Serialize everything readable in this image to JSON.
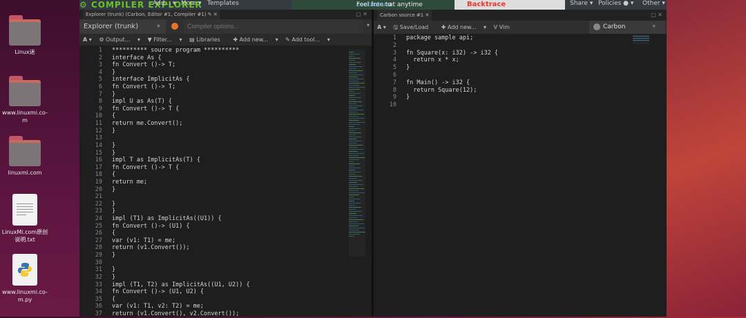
{
  "desktop": {
    "icons": [
      {
        "label": "Linux迷",
        "type": "folder"
      },
      {
        "label": "www.linuxmi.co-m",
        "type": "folder"
      },
      {
        "label": "linuxmi.com",
        "type": "folder"
      },
      {
        "label": "LinuxMi.com原创说明.txt",
        "type": "text-file"
      },
      {
        "label": "www.linuxmi.co-m.py",
        "type": "python-file"
      }
    ]
  },
  "nav": {
    "logo": "COMPILER EXPLORER",
    "add": "Add...",
    "more": "More",
    "templates": "Templates",
    "notice_prefix": "Feel free to ",
    "notice_link": "contact us",
    "notice_suffix": " at anytime",
    "sponsor": "Backtrace",
    "share": "Share",
    "policies": "Policies",
    "other": "Other"
  },
  "compiler_pane": {
    "tab": "Explorer (trunk) (Carbon, Editor #1, Compiler #1)",
    "compiler": "Explorer (trunk)",
    "options_placeholder": "Compiler options...",
    "toolbar": {
      "font": "A",
      "output": "Output...",
      "filter": "Filter...",
      "libraries": "Libraries",
      "add_new": "Add new...",
      "add_tool": "Add tool..."
    },
    "lines": [
      "********** source program **********",
      "interface As {",
      "fn Convert ()-> T;",
      "}",
      "interface ImplicitAs {",
      "fn Convert ()-> T;",
      "}",
      "impl U as As(T) {",
      "fn Convert ()-> T {",
      "{",
      "return me.Convert();",
      "}",
      "",
      "}",
      "}",
      "impl T as ImplicitAs(T) {",
      "fn Convert ()-> T {",
      "{",
      "return me;",
      "}",
      "",
      "}",
      "}",
      "impl (T1) as ImplicitAs((U1)) {",
      "fn Convert ()-> (U1) {",
      "{",
      "var (v1: T1) = me;",
      "return (v1.Convert());",
      "}",
      "",
      "}",
      "}",
      "impl (T1, T2) as ImplicitAs((U1, U2)) {",
      "fn Convert ()-> (U1, U2) {",
      "{",
      "var (v1: T1, v2: T2) = me;",
      "return (v1.Convert(), v2.Convert());"
    ]
  },
  "source_pane": {
    "tab": "Carbon source #1",
    "toolbar": {
      "font": "A",
      "save_load": "Save/Load",
      "add_new": "Add new...",
      "vim": "Vim"
    },
    "language": "Carbon",
    "lines": [
      "package sample api;",
      "",
      "fn Square(x: i32) -> i32 {",
      "  return x * x;",
      "}",
      "",
      "fn Main() -> i32 {",
      "  return Square(12);",
      "}",
      ""
    ]
  }
}
